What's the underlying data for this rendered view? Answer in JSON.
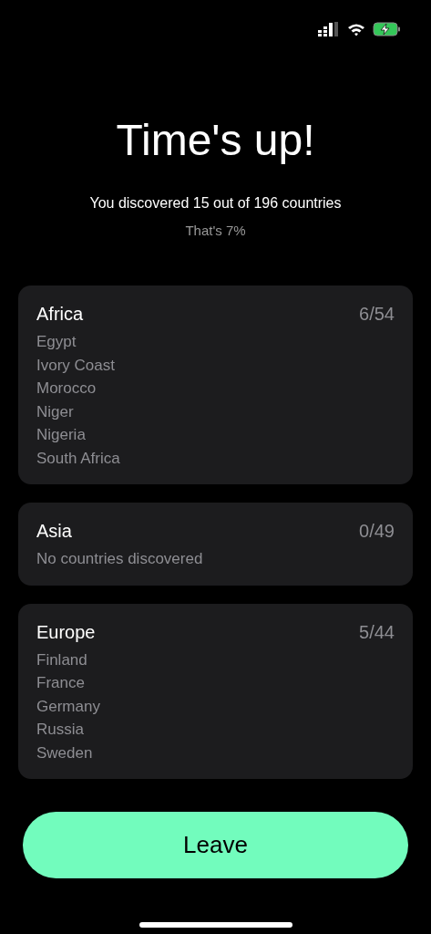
{
  "title": "Time's up!",
  "summary": "You discovered 15 out of 196 countries",
  "percentage": "That's 7%",
  "continents": [
    {
      "name": "Africa",
      "score": "6/54",
      "countries": [
        "Egypt",
        "Ivory Coast",
        "Morocco",
        "Niger",
        "Nigeria",
        "South Africa"
      ]
    },
    {
      "name": "Asia",
      "score": "0/49",
      "empty_message": "No countries discovered"
    },
    {
      "name": "Europe",
      "score": "5/44",
      "countries": [
        "Finland",
        "France",
        "Germany",
        "Russia",
        "Sweden"
      ]
    }
  ],
  "button": "Leave"
}
